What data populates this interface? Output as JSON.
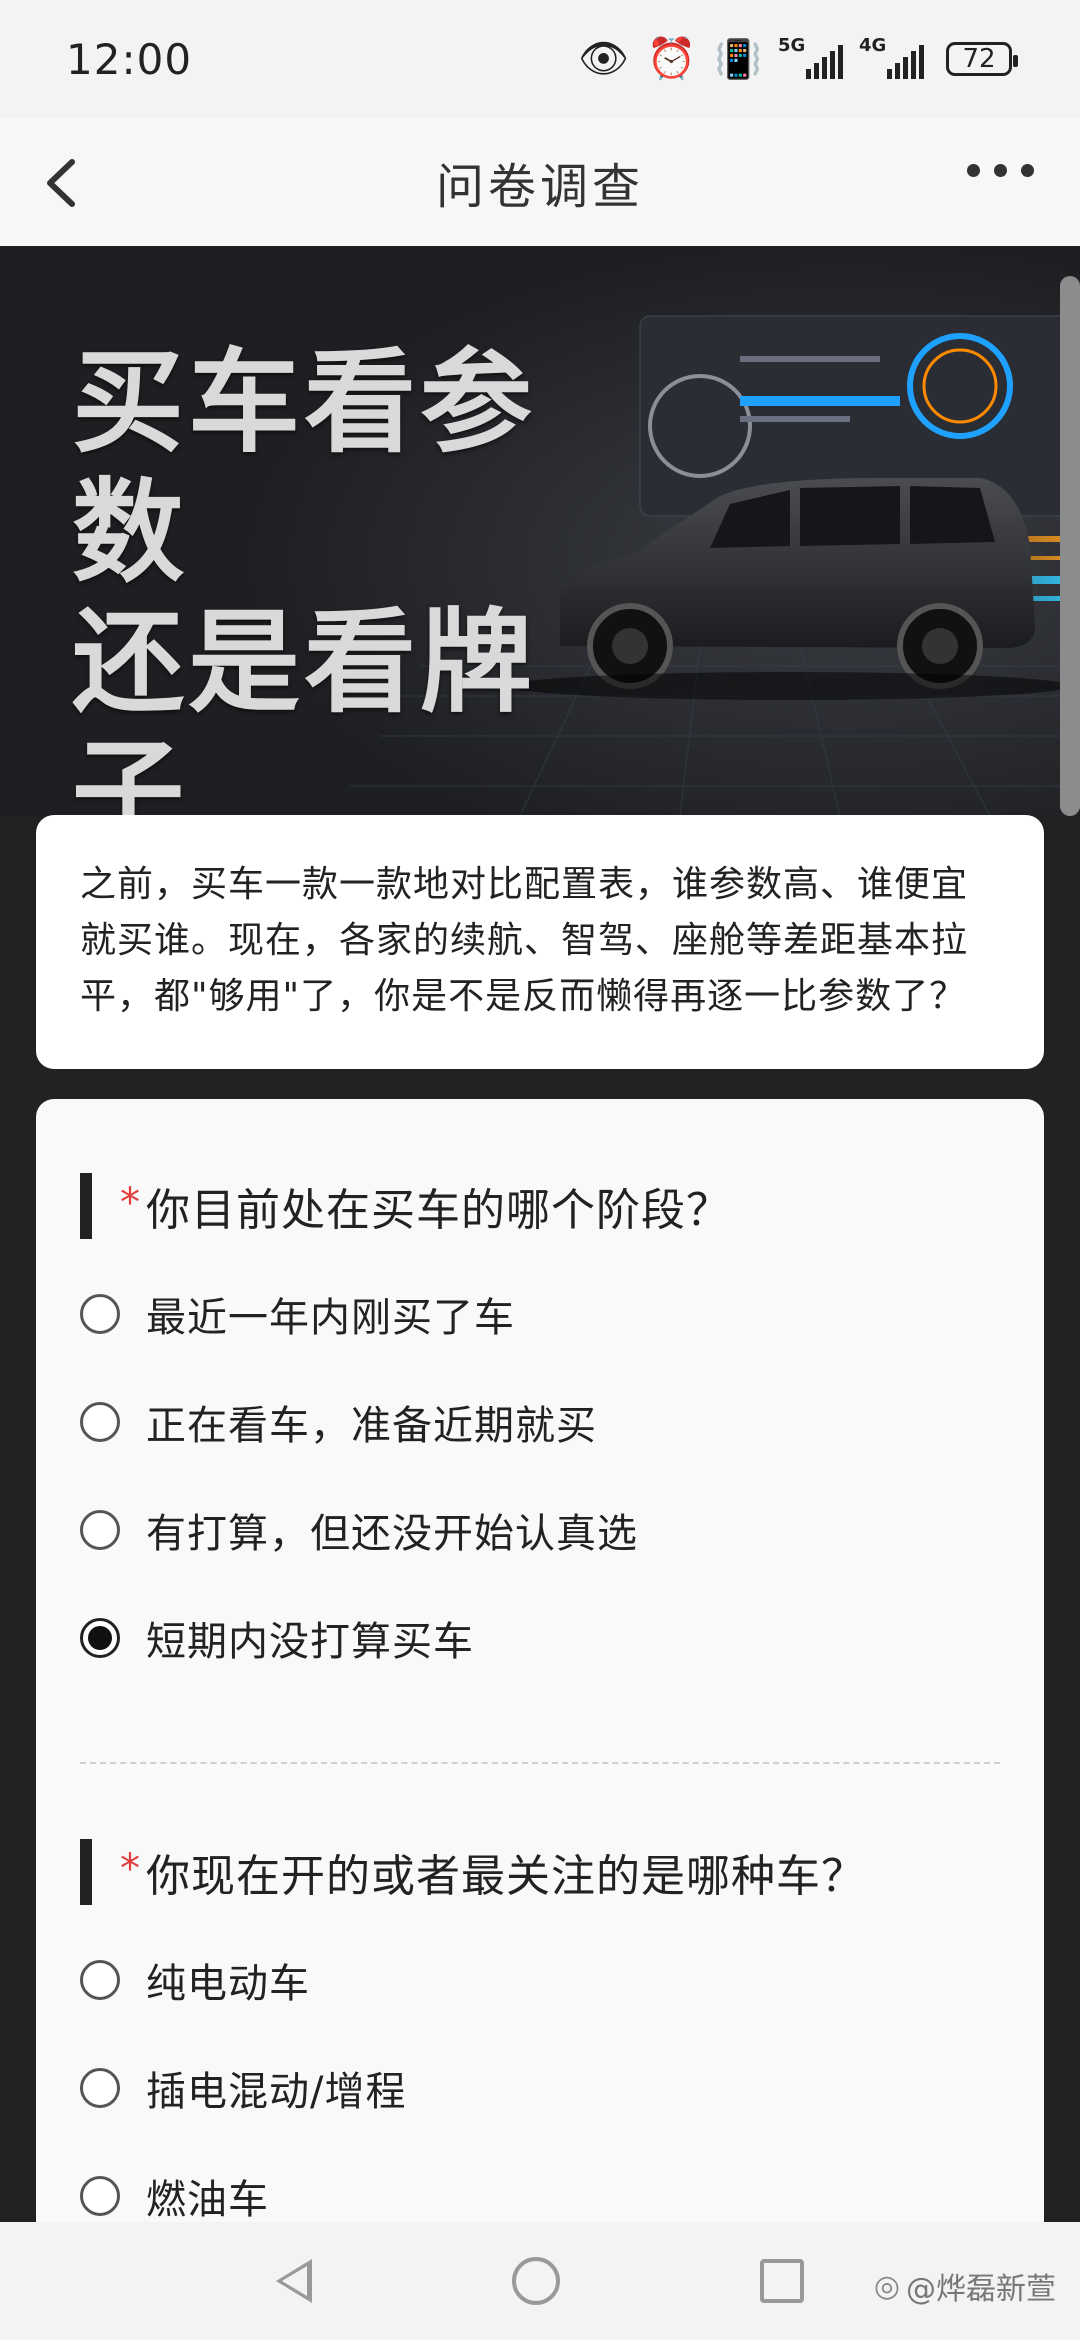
{
  "status_bar": {
    "time": "12:00",
    "signal1_label": "5G",
    "signal2_label": "4G",
    "battery": "72"
  },
  "nav": {
    "title": "问卷调查"
  },
  "banner": {
    "title_line1": "买车看参数",
    "title_line2": "还是看牌子"
  },
  "intro": {
    "text": "之前，买车一款一款地对比配置表，谁参数高、谁便宜就买谁。现在，各家的续航、智驾、座舱等差距基本拉平，都\"够用\"了，你是不是反而懒得再逐一比参数了？"
  },
  "questions": [
    {
      "required_mark": "*",
      "text": "你目前处在买车的哪个阶段？",
      "options": [
        {
          "label": "最近一年内刚买了车",
          "selected": false
        },
        {
          "label": "正在看车，准备近期就买",
          "selected": false
        },
        {
          "label": "有打算，但还没开始认真选",
          "selected": false
        },
        {
          "label": "短期内没打算买车",
          "selected": true
        }
      ]
    },
    {
      "required_mark": "*",
      "text": "你现在开的或者最关注的是哪种车？",
      "options": [
        {
          "label": "纯电动车",
          "selected": false
        },
        {
          "label": "插电混动/增程",
          "selected": false
        },
        {
          "label": "燃油车",
          "selected": false
        }
      ]
    }
  ],
  "watermark": "@烨磊新萱"
}
